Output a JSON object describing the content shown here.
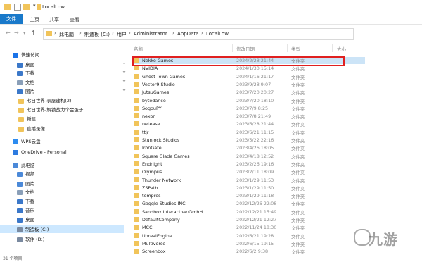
{
  "window": {
    "title": "LocalLow"
  },
  "ribbon": {
    "tabs": [
      "文件",
      "主页",
      "共享",
      "查看"
    ]
  },
  "address": {
    "segments": [
      "此电脑",
      "制造板 (C:)",
      "用户",
      "Administrator",
      "AppData",
      "LocalLow"
    ]
  },
  "sidebar": {
    "items": [
      {
        "label": "快速访问",
        "icon": "star-icon",
        "color": "#1a73e8",
        "pinned": false
      },
      {
        "label": "桌面",
        "icon": "desktop-icon",
        "color": "#3b78c9",
        "pinned": true
      },
      {
        "label": "下载",
        "icon": "download-icon",
        "color": "#3b78c9",
        "pinned": true
      },
      {
        "label": "文档",
        "icon": "document-icon",
        "color": "#8a9fb8",
        "pinned": true
      },
      {
        "label": "图片",
        "icon": "picture-icon",
        "color": "#3b78c9",
        "pinned": true
      },
      {
        "label": "七日世界-表屋建构(2)",
        "icon": "folder-icon",
        "color": "#f1c45a",
        "pinned": false
      },
      {
        "label": "七日世界-解锁战力个金蛋子",
        "icon": "folder-icon",
        "color": "#f1c45a",
        "pinned": false
      },
      {
        "label": "新建",
        "icon": "folder-icon",
        "color": "#f1c45a",
        "pinned": false
      },
      {
        "label": "直播录像",
        "icon": "folder-icon",
        "color": "#f1c45a",
        "pinned": false
      },
      {
        "label": "WPS云盘",
        "icon": "cloud-icon",
        "color": "#2d8cf0",
        "pinned": false
      },
      {
        "label": "OneDrive - Personal",
        "icon": "onedrive-icon",
        "color": "#2d7be0",
        "pinned": false
      },
      {
        "label": "此电脑",
        "icon": "computer-icon",
        "color": "#4b89d8",
        "pinned": false
      },
      {
        "label": "视频",
        "icon": "video-icon",
        "color": "#4b89d8",
        "pinned": false
      },
      {
        "label": "图片",
        "icon": "picture-icon",
        "color": "#4b89d8",
        "pinned": false
      },
      {
        "label": "文档",
        "icon": "document-icon",
        "color": "#8a9fb8",
        "pinned": false
      },
      {
        "label": "下载",
        "icon": "download-icon",
        "color": "#3b78c9",
        "pinned": false
      },
      {
        "label": "音乐",
        "icon": "music-icon",
        "color": "#3b78c9",
        "pinned": false
      },
      {
        "label": "桌面",
        "icon": "desktop-icon",
        "color": "#3b78c9",
        "pinned": false
      },
      {
        "label": "制造板 (C:)",
        "icon": "drive-icon",
        "color": "#7a8aa0",
        "pinned": false
      },
      {
        "label": "软件 (D:)",
        "icon": "drive-icon",
        "color": "#7a8aa0",
        "pinned": false
      }
    ],
    "status": "31 个项目"
  },
  "columns": {
    "name": "名称",
    "date": "修改日期",
    "type": "类型",
    "size": "大小"
  },
  "files": [
    {
      "name": "Nekke Games",
      "date": "2024/2/28 21:44",
      "type": "文件夹"
    },
    {
      "name": "NVIDIA",
      "date": "2024/1/30 15:14",
      "type": "文件夹"
    },
    {
      "name": "Ghost Town Games",
      "date": "2024/1/16 21:17",
      "type": "文件夹"
    },
    {
      "name": "Vector9 Studio",
      "date": "2023/9/28 9:07",
      "type": "文件夹"
    },
    {
      "name": "JutsuGames",
      "date": "2023/7/20 20:27",
      "type": "文件夹"
    },
    {
      "name": "bytedance",
      "date": "2023/7/20 18:10",
      "type": "文件夹"
    },
    {
      "name": "SogouPY",
      "date": "2023/7/9 8:25",
      "type": "文件夹"
    },
    {
      "name": "nexon",
      "date": "2023/7/8 21:49",
      "type": "文件夹"
    },
    {
      "name": "netease",
      "date": "2023/6/28 21:44",
      "type": "文件夹"
    },
    {
      "name": "ttjr",
      "date": "2023/6/21 11:15",
      "type": "文件夹"
    },
    {
      "name": "Stunlock Studios",
      "date": "2023/5/22 22:16",
      "type": "文件夹"
    },
    {
      "name": "IronGate",
      "date": "2023/4/26 18:05",
      "type": "文件夹"
    },
    {
      "name": "Square Glade Games",
      "date": "2023/4/18 12:52",
      "type": "文件夹"
    },
    {
      "name": "Endnight",
      "date": "2023/2/26 19:16",
      "type": "文件夹"
    },
    {
      "name": "Olympus",
      "date": "2023/2/11 18:09",
      "type": "文件夹"
    },
    {
      "name": "Thunder Network",
      "date": "2023/1/29 11:53",
      "type": "文件夹"
    },
    {
      "name": "ZSPath",
      "date": "2023/1/29 11:50",
      "type": "文件夹"
    },
    {
      "name": "tempres",
      "date": "2023/1/29 11:18",
      "type": "文件夹"
    },
    {
      "name": "Gaggle Studios INC",
      "date": "2022/12/26 22:08",
      "type": "文件夹"
    },
    {
      "name": "Sandbox Interactive GmbH",
      "date": "2022/12/21 15:49",
      "type": "文件夹"
    },
    {
      "name": "DefaultCompany",
      "date": "2022/12/21 12:27",
      "type": "文件夹"
    },
    {
      "name": "MCC",
      "date": "2022/11/24 18:30",
      "type": "文件夹"
    },
    {
      "name": "UnrealEngine",
      "date": "2022/6/21 19:28",
      "type": "文件夹"
    },
    {
      "name": "Multiverse",
      "date": "2022/6/15 19:15",
      "type": "文件夹"
    },
    {
      "name": "Screenbox",
      "date": "2022/6/2 9:38",
      "type": "文件夹"
    }
  ],
  "watermark": {
    "text": "九游"
  },
  "colors": {
    "accent": "#1979ca",
    "highlight": "#e02020",
    "folder": "#f1c45a"
  }
}
